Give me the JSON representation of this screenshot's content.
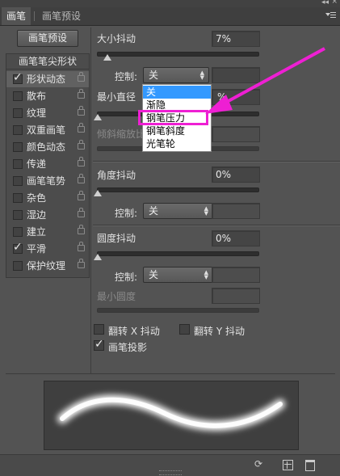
{
  "tabs": {
    "brush": "画笔",
    "brush_presets": "画笔预设"
  },
  "preset_button": "画笔预设",
  "list_header": "画笔笔尖形状",
  "options": [
    {
      "label": "形状动态",
      "checked": true,
      "selected": true,
      "lock": true
    },
    {
      "label": "散布",
      "checked": false,
      "lock": true
    },
    {
      "label": "纹理",
      "checked": false,
      "lock": true
    },
    {
      "label": "双重画笔",
      "checked": false,
      "lock": true
    },
    {
      "label": "颜色动态",
      "checked": false,
      "lock": true
    },
    {
      "label": "传递",
      "checked": false,
      "lock": true
    },
    {
      "label": "画笔笔势",
      "checked": false,
      "lock": true
    },
    {
      "label": "杂色",
      "checked": false,
      "lock": true
    },
    {
      "label": "湿边",
      "checked": false,
      "lock": true
    },
    {
      "label": "建立",
      "checked": false,
      "lock": true
    },
    {
      "label": "平滑",
      "checked": true,
      "lock": true
    },
    {
      "label": "保护纹理",
      "checked": false,
      "lock": true
    }
  ],
  "size_jitter": {
    "label": "大小抖动",
    "value": "7%",
    "level_percent": 7
  },
  "control_label": "控制:",
  "control1_value": "关",
  "min_diameter": {
    "label": "最小直径",
    "value": "%"
  },
  "tilt_scale": {
    "label": "倾斜缩放比"
  },
  "dropdown_items": [
    "关",
    "渐隐",
    "钢笔压力",
    "钢笔斜度",
    "光笔轮"
  ],
  "angle_jitter": {
    "label": "角度抖动",
    "value": "0%",
    "level_percent": 0
  },
  "control2_value": "关",
  "roundness_jitter": {
    "label": "圆度抖动",
    "value": "0%",
    "level_percent": 0
  },
  "control3_value": "关",
  "min_roundness": {
    "label": "最小圆度"
  },
  "flip_x": {
    "label": "翻转 X 抖动",
    "checked": false
  },
  "flip_y": {
    "label": "翻转 Y 抖动",
    "checked": false
  },
  "brush_projection": {
    "label": "画笔投影",
    "checked": true
  },
  "panel_menu_icon": "panel-menu-icon",
  "collapse_icon": "double-chevron-icon",
  "colors": {
    "highlight": "#ee1fd3",
    "selection": "#3399ff",
    "panel": "#535353"
  }
}
